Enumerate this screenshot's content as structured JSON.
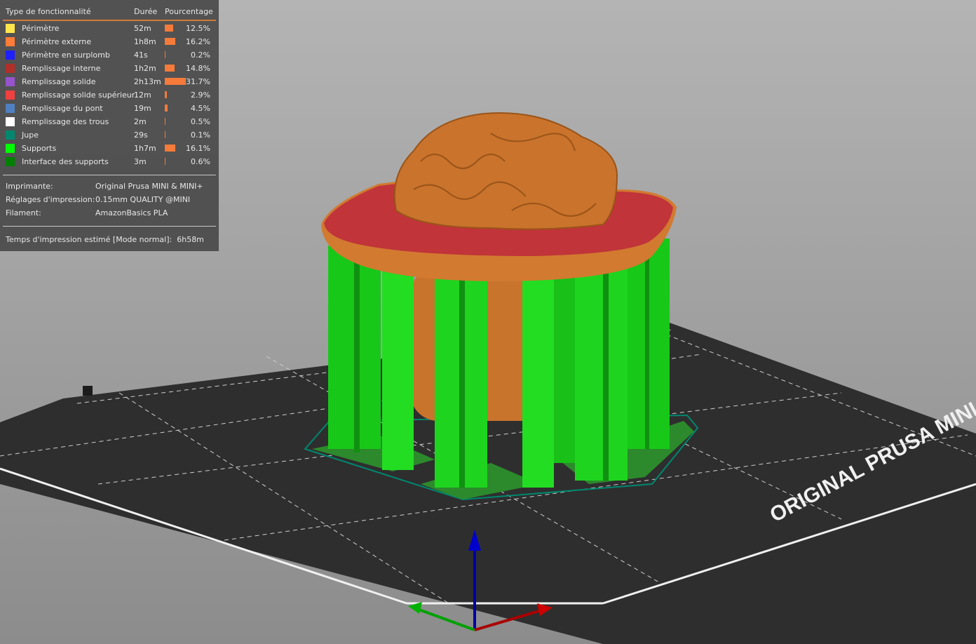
{
  "legend": {
    "headers": {
      "type": "Type de fonctionnalité",
      "duration": "Durée",
      "percent": "Pourcentage"
    },
    "accent_color": "#d07a3a",
    "bar_color": "#f47b3a",
    "rows": [
      {
        "color": "#ffe64d",
        "name": "Périmètre",
        "duration": "52m",
        "percent": "12.5%",
        "value": 12.5
      },
      {
        "color": "#ff7d38",
        "name": "Périmètre externe",
        "duration": "1h8m",
        "percent": "16.2%",
        "value": 16.2
      },
      {
        "color": "#1f1fff",
        "name": "Périmètre en surplomb",
        "duration": "41s",
        "percent": "0.2%",
        "value": 0.2
      },
      {
        "color": "#b03029",
        "name": "Remplissage interne",
        "duration": "1h2m",
        "percent": "14.8%",
        "value": 14.8
      },
      {
        "color": "#9654cc",
        "name": "Remplissage solide",
        "duration": "2h13m",
        "percent": "31.7%",
        "value": 31.7
      },
      {
        "color": "#f04040",
        "name": "Remplissage solide supérieur",
        "duration": "12m",
        "percent": "2.9%",
        "value": 2.9
      },
      {
        "color": "#5080c0",
        "name": "Remplissage du pont",
        "duration": "19m",
        "percent": "4.5%",
        "value": 4.5
      },
      {
        "color": "#ffffff",
        "name": "Remplissage des trous",
        "duration": "2m",
        "percent": "0.5%",
        "value": 0.5
      },
      {
        "color": "#00876e",
        "name": "Jupe",
        "duration": "29s",
        "percent": "0.1%",
        "value": 0.1
      },
      {
        "color": "#00ff00",
        "name": "Supports",
        "duration": "1h7m",
        "percent": "16.1%",
        "value": 16.1
      },
      {
        "color": "#008000",
        "name": "Interface des supports",
        "duration": "3m",
        "percent": "0.6%",
        "value": 0.6
      }
    ],
    "printer_label": "Imprimante:",
    "printer_value": "Original Prusa MINI & MINI+",
    "settings_label": "Réglages d'impression:",
    "settings_value": "0.15mm QUALITY @MINI",
    "filament_label": "Filament:",
    "filament_value": "AmazonBasics PLA",
    "time_label": "Temps d'impression estimé [Mode normal]:",
    "time_value": "6h58m"
  },
  "bed": {
    "logo_text": "ORIGINAL PRUSA MINI"
  }
}
